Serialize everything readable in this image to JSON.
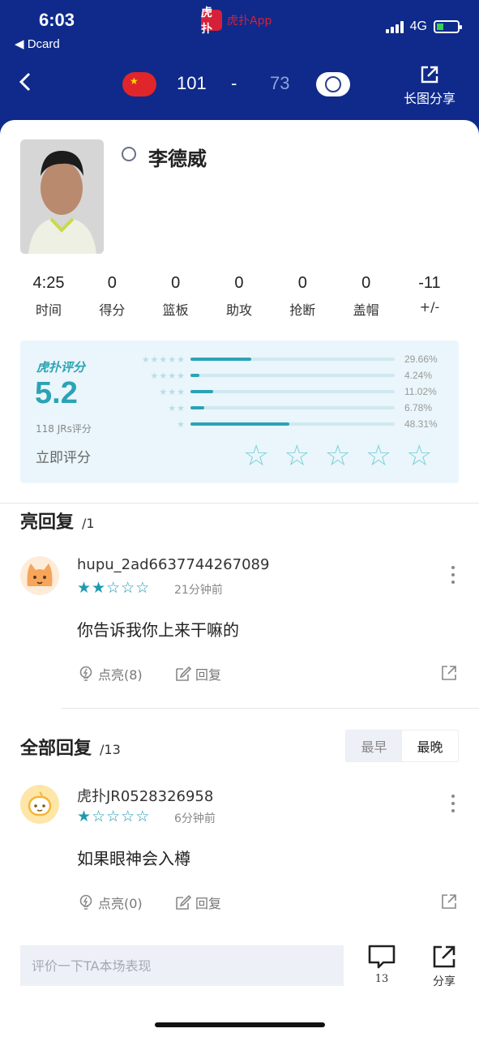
{
  "status_bar": {
    "time": "6:03",
    "back_app": "◀ Dcard",
    "app_badge": "虎扑",
    "app_name": "虎扑App",
    "network": "4G"
  },
  "header": {
    "team_a_score": "101",
    "separator": "-",
    "team_b_score": "73",
    "share_label": "长图分享"
  },
  "player": {
    "name": "李德威"
  },
  "stats": [
    {
      "value": "4:25",
      "label": "时间"
    },
    {
      "value": "0",
      "label": "得分"
    },
    {
      "value": "0",
      "label": "篮板"
    },
    {
      "value": "0",
      "label": "助攻"
    },
    {
      "value": "0",
      "label": "抢断"
    },
    {
      "value": "0",
      "label": "盖帽"
    },
    {
      "value": "-11",
      "label": "+/-"
    }
  ],
  "rating": {
    "logo": "虎扑评分",
    "score": "5.2",
    "count": "118 JRs评分",
    "rate_now": "立即评分",
    "distribution": [
      {
        "stars": "★★★★★",
        "pct_value": 29.66,
        "pct": "29.66%"
      },
      {
        "stars": "★★★★",
        "pct_value": 4.24,
        "pct": "4.24%"
      },
      {
        "stars": "★★★",
        "pct_value": 11.02,
        "pct": "11.02%"
      },
      {
        "stars": "★★",
        "pct_value": 6.78,
        "pct": "6.78%"
      },
      {
        "stars": "★",
        "pct_value": 48.31,
        "pct": "48.31%"
      }
    ]
  },
  "highlight_section": {
    "title": "亮回复",
    "count": "/1"
  },
  "all_section": {
    "title": "全部回复",
    "count": "/13",
    "sort_early": "最早",
    "sort_late": "最晚"
  },
  "comments": [
    {
      "user": "hupu_2ad6637744267089",
      "stars_filled": 2,
      "time": "21分钟前",
      "text": "你告诉我你上来干嘛的",
      "like_label": "点亮(8)",
      "reply_label": "回复"
    },
    {
      "user": "虎扑JR0528326958",
      "stars_filled": 1,
      "time": "6分钟前",
      "text": "如果眼神会入樽",
      "like_label": "点亮(0)",
      "reply_label": "回复"
    }
  ],
  "bottom_bar": {
    "input_placeholder": "评价一下TA本场表现",
    "comment_count": "13",
    "share_label": "分享"
  },
  "colors": {
    "header_bg": "#0f2a8a",
    "accent": "#2aa3b5",
    "star": "#1e9ab0"
  }
}
